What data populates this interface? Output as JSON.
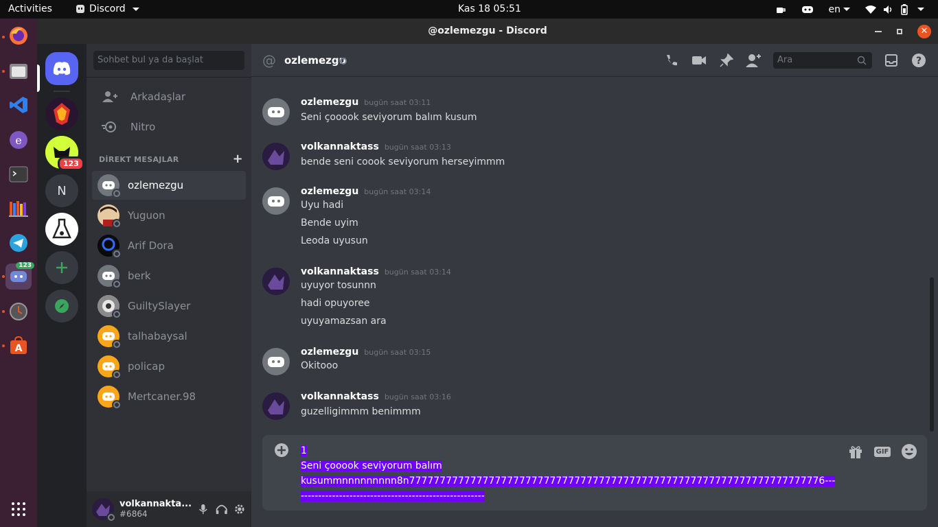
{
  "topbar": {
    "activities": "Activities",
    "app": "Discord",
    "clock": "Kas 18  05:51",
    "lang": "en"
  },
  "window": {
    "title": "@ozlemezgu - Discord"
  },
  "guilds": {
    "badge_count": "123",
    "letter_server": "N"
  },
  "dock": {
    "discord_badge": "123"
  },
  "sidebar": {
    "search_placeholder": "Sohbet bul ya da başlat",
    "nav": [
      {
        "label": "Arkadaşlar"
      },
      {
        "label": "Nitro"
      }
    ],
    "dm_header": "DİREKT MESAJLAR",
    "dms": [
      {
        "name": "ozlemezgu",
        "color": "#72767d"
      },
      {
        "name": "Yuguon",
        "color": "#5a3a1e"
      },
      {
        "name": "Arif Dora",
        "color": "#0a0a0a"
      },
      {
        "name": "berk",
        "color": "#72767d"
      },
      {
        "name": "GuiltySlayer",
        "color": "#aaaaaa"
      },
      {
        "name": "talhabaysal",
        "color": "#faa61a"
      },
      {
        "name": "policap",
        "color": "#faa61a"
      },
      {
        "name": "Mertcaner.98",
        "color": "#faa61a"
      }
    ],
    "user": {
      "name": "volkannakta...",
      "tag": "#6864"
    }
  },
  "chat": {
    "channel": "ozlemezgu",
    "search_placeholder": "Ara",
    "messages": [
      {
        "author": "ozlemezgu",
        "time": "bugün saat 03:11",
        "lines": [
          "Seni çooook seviyorum balım kusum"
        ]
      },
      {
        "author": "volkannaktass",
        "time": "bugün saat 03:13",
        "lines": [
          "bende seni coook seviyorum herseyimmm"
        ]
      },
      {
        "author": "ozlemezgu",
        "time": "bugün saat 03:14",
        "lines": [
          "Uyu hadi",
          "Bende uyim",
          "Leoda uyusun"
        ]
      },
      {
        "author": "volkannaktass",
        "time": "bugün saat 03:14",
        "lines": [
          "uyuyor tosunnn",
          "hadi opuyoree",
          "uyuyamazsan ara"
        ]
      },
      {
        "author": "ozlemezgu",
        "time": "bugün saat 03:15",
        "lines": [
          "Okitooo"
        ]
      },
      {
        "author": "volkannaktass",
        "time": "bugün saat 03:16",
        "lines": [
          "guzelligimmm benimmm"
        ]
      }
    ],
    "composer": {
      "lines": [
        "1",
        "Seni çooook seviyorum balım ",
        "kusummnnnnnnnnn8n77777777777777777777777777777777777777777777777777777777777777777776---",
        "-----------------------------------------------------"
      ],
      "gif_label": "GIF"
    }
  }
}
